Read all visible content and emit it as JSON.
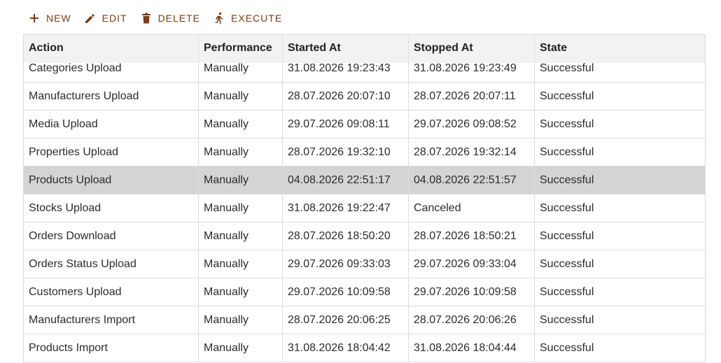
{
  "toolbar": {
    "new_label": "NEW",
    "new_icon": "plus-icon",
    "edit_label": "EDIT",
    "edit_icon": "pencil-icon",
    "delete_label": "DELETE",
    "delete_icon": "trash-icon",
    "execute_label": "EXECUTE",
    "execute_icon": "running-person-icon",
    "accent_color": "#7a3c12"
  },
  "table": {
    "columns": [
      "Action",
      "Performance",
      "Started At",
      "Stopped At",
      "State"
    ],
    "selected_row_color": "#d4d4d4",
    "rows": [
      [
        "Categories Upload",
        "Manually",
        "31.08.2026 19:23:43",
        "31.08.2026 19:23:49",
        "Successful"
      ],
      [
        "Manufacturers Upload",
        "Manually",
        "28.07.2026 20:07:10",
        "28.07.2026 20:07:11",
        "Successful"
      ],
      [
        "Media Upload",
        "Manually",
        "29.07.2026 09:08:11",
        "29.07.2026 09:08:52",
        "Successful"
      ],
      [
        "Properties Upload",
        "Manually",
        "28.07.2026 19:32:10",
        "28.07.2026 19:32:14",
        "Successful"
      ],
      [
        "Products Upload",
        "Manually",
        "04.08.2026 22:51:17",
        "04.08.2026 22:51:57",
        "Successful"
      ],
      [
        "Stocks Upload",
        "Manually",
        "31.08.2026 19:22:47",
        "Canceled",
        "Successful"
      ],
      [
        "Orders Download",
        "Manually",
        "28.07.2026 18:50:20",
        "28.07.2026 18:50:21",
        "Successful"
      ],
      [
        "Orders Status Upload",
        "Manually",
        "29.07.2026 09:33:03",
        "29.07.2026 09:33:04",
        "Successful"
      ],
      [
        "Customers Upload",
        "Manually",
        "29.07.2026 10:09:58",
        "29.07.2026 10:09:58",
        "Successful"
      ],
      [
        "Manufacturers Import",
        "Manually",
        "28.07.2026 20:06:25",
        "28.07.2026 20:06:26",
        "Successful"
      ],
      [
        "Products Import",
        "Manually",
        "31.08.2026 18:04:42",
        "31.08.2026 18:04:44",
        "Successful"
      ]
    ],
    "selected_index": 4
  }
}
